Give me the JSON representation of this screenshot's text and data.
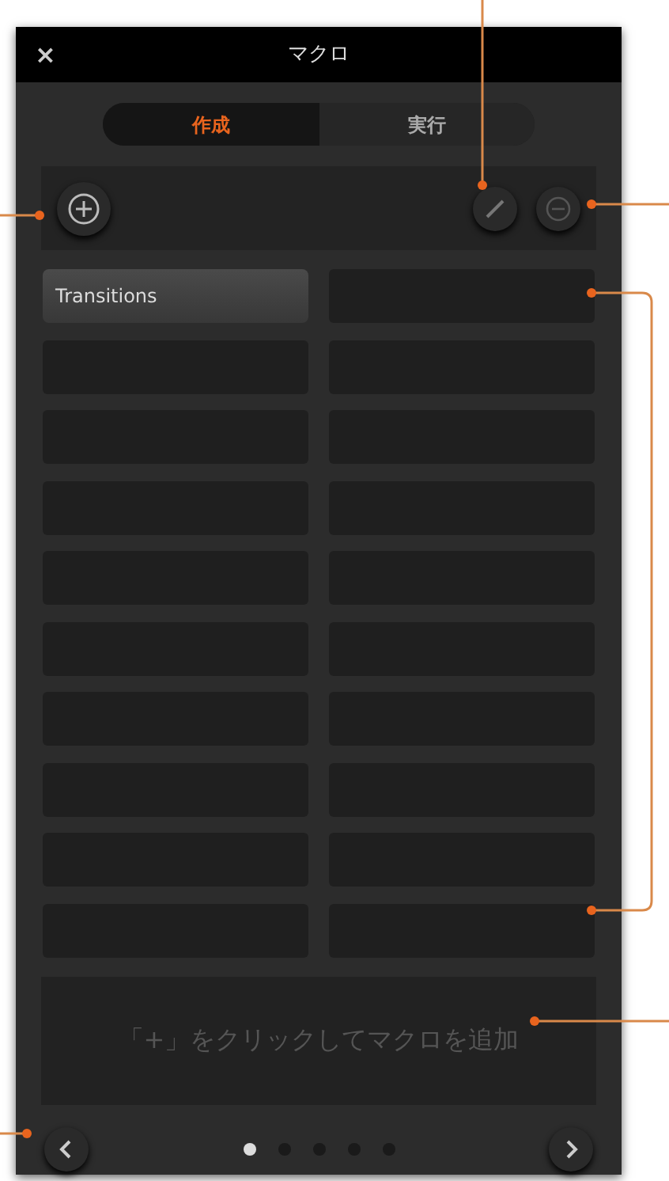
{
  "window": {
    "close": "×",
    "title": "マクロ"
  },
  "tabs": [
    {
      "label": "作成",
      "selected": true
    },
    {
      "label": "実行",
      "selected": false
    }
  ],
  "slots": [
    {
      "kind": "macro",
      "label": "Transitions"
    },
    {
      "kind": "empty"
    },
    {
      "kind": "empty"
    },
    {
      "kind": "empty"
    },
    {
      "kind": "empty"
    },
    {
      "kind": "empty"
    },
    {
      "kind": "empty"
    },
    {
      "kind": "empty"
    },
    {
      "kind": "empty"
    },
    {
      "kind": "empty"
    },
    {
      "kind": "empty"
    },
    {
      "kind": "empty"
    },
    {
      "kind": "empty"
    },
    {
      "kind": "empty"
    },
    {
      "kind": "empty"
    },
    {
      "kind": "empty"
    },
    {
      "kind": "empty"
    },
    {
      "kind": "empty"
    },
    {
      "kind": "empty"
    },
    {
      "kind": "empty"
    }
  ],
  "message": "「+」をクリックしてマクロを追加",
  "pages": [
    {
      "selected": true
    },
    {
      "selected": false
    },
    {
      "selected": false
    },
    {
      "selected": false
    },
    {
      "selected": false
    }
  ]
}
